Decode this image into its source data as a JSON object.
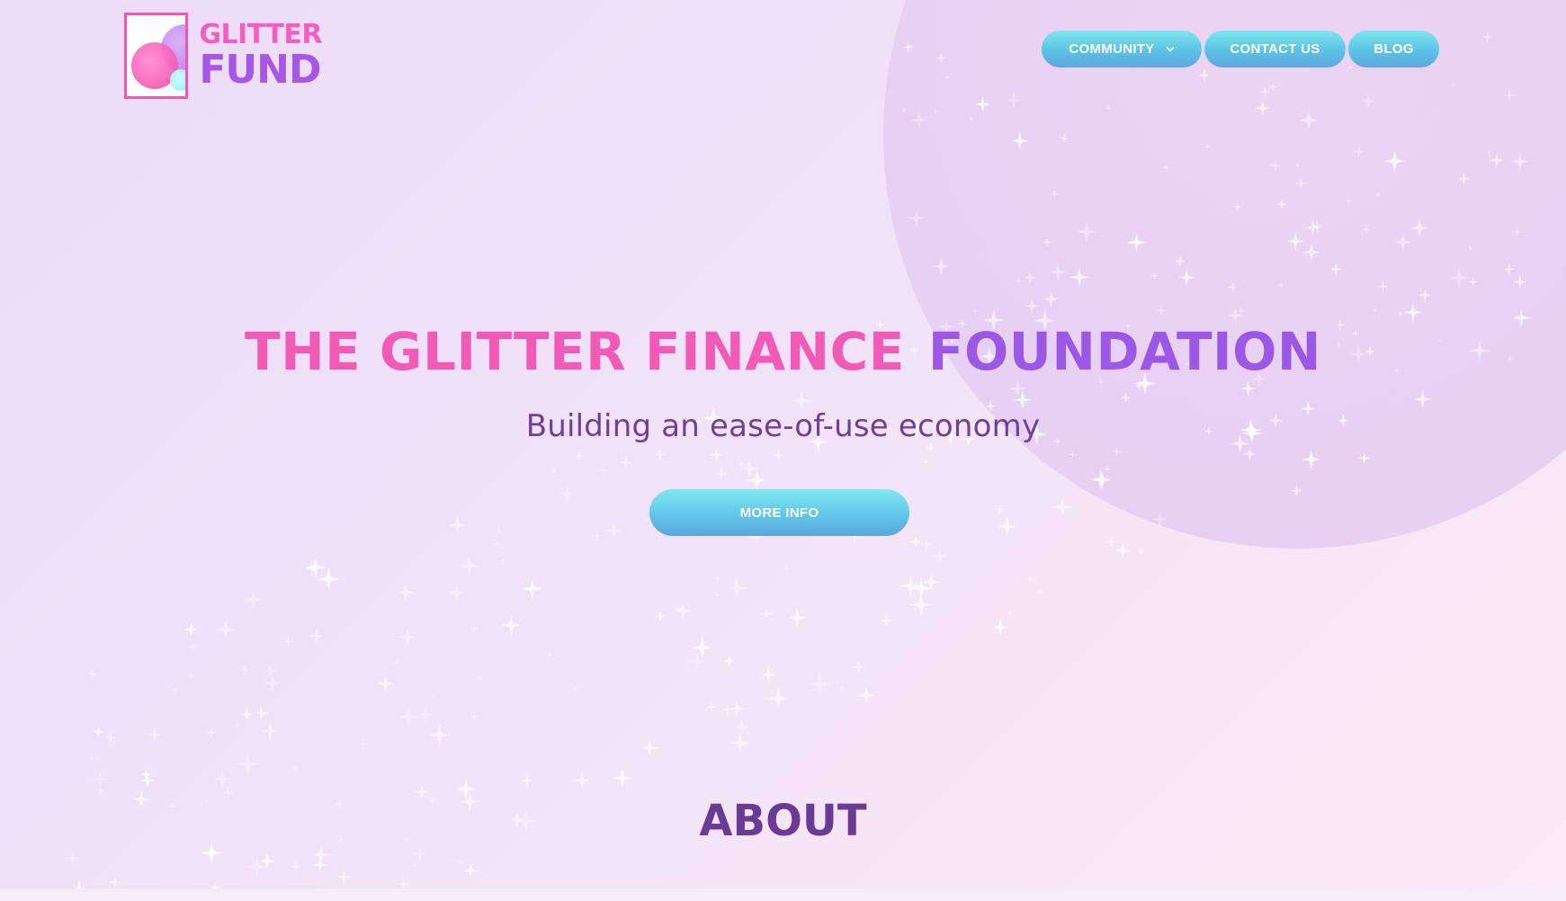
{
  "brand": {
    "logo_top": "GLITTER",
    "logo_bottom": "FUND",
    "colors": {
      "pink": "#f25bb5",
      "purple": "#9b58e4",
      "cyan_button": "#62c6e8",
      "deep_purple": "#6a3b94"
    }
  },
  "nav": {
    "community": "COMMUNITY",
    "community_icon": "chevron-down-icon",
    "contact": "CONTACT US",
    "blog": "BLOG"
  },
  "hero": {
    "title_part1": "THE GLITTER FINANCE",
    "title_part2": "FOUNDATION",
    "subtitle": "Building an ease-of-use economy",
    "cta": "MORE INFO"
  },
  "about": {
    "heading": "ABOUT"
  }
}
